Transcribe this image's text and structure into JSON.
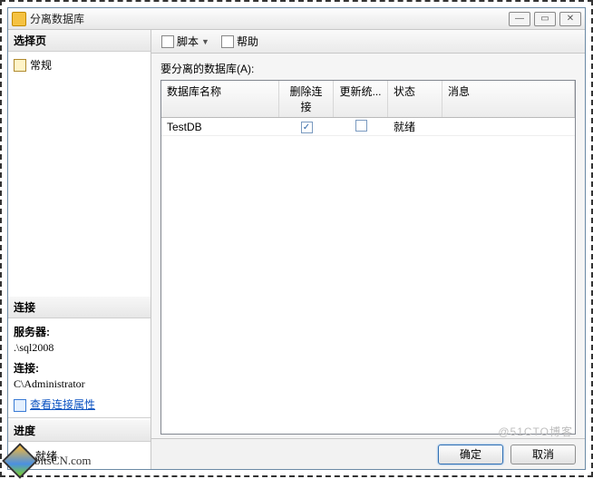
{
  "window": {
    "title": "分离数据库"
  },
  "sidebar": {
    "select_page": "选择页",
    "page_general": "常规",
    "connection_title": "连接",
    "server_label": "服务器:",
    "server_value": ".\\sql2008",
    "conn_label": "连接:",
    "conn_value": "C\\Administrator",
    "view_conn_props": "查看连接属性",
    "progress_title": "进度",
    "progress_status": "就绪"
  },
  "toolbar": {
    "script": "脚本",
    "help": "帮助"
  },
  "main": {
    "field_label": "要分离的数据库(A):",
    "columns": {
      "name": "数据库名称",
      "drop": "删除连接",
      "update": "更新统...",
      "status": "状态",
      "message": "消息"
    },
    "row": {
      "name": "TestDB",
      "drop_checked": true,
      "update_checked": false,
      "status": "就绪",
      "message": ""
    }
  },
  "footer": {
    "ok": "确定",
    "cancel": "取消"
  },
  "branding": {
    "watermark": "@51CTO博客",
    "logo_text": "bitsCN.com"
  }
}
